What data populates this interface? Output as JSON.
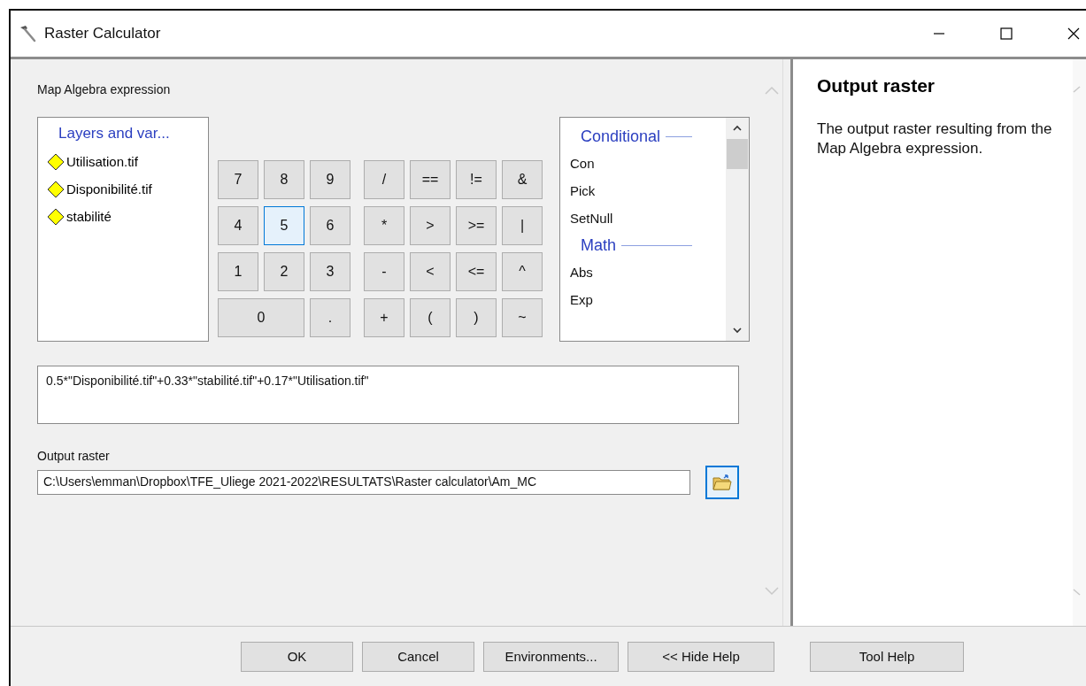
{
  "window": {
    "title": "Raster Calculator"
  },
  "expression_label": "Map Algebra expression",
  "layers": {
    "header": "Layers and var...",
    "items": [
      {
        "name": "Utilisation.tif"
      },
      {
        "name": "Disponibilité.tif"
      },
      {
        "name": "stabilité"
      }
    ]
  },
  "keypad": [
    {
      "label": "7",
      "highlighted": false
    },
    {
      "label": "8",
      "highlighted": false
    },
    {
      "label": "9",
      "highlighted": false
    },
    {
      "label": "4",
      "highlighted": false
    },
    {
      "label": "5",
      "highlighted": true
    },
    {
      "label": "6",
      "highlighted": false
    },
    {
      "label": "1",
      "highlighted": false
    },
    {
      "label": "2",
      "highlighted": false
    },
    {
      "label": "3",
      "highlighted": false
    },
    {
      "label": "0",
      "highlighted": false
    },
    {
      "label": ".",
      "highlighted": false
    }
  ],
  "operators": [
    {
      "label": "/",
      "highlighted": false
    },
    {
      "label": "==",
      "highlighted": false
    },
    {
      "label": "!=",
      "highlighted": false
    },
    {
      "label": "&",
      "highlighted": false
    },
    {
      "label": "*",
      "highlighted": false
    },
    {
      "label": ">",
      "highlighted": false
    },
    {
      "label": ">=",
      "highlighted": false
    },
    {
      "label": "|",
      "highlighted": false
    },
    {
      "label": "-",
      "highlighted": false
    },
    {
      "label": "<",
      "highlighted": false
    },
    {
      "label": "<=",
      "highlighted": false
    },
    {
      "label": "^",
      "highlighted": false
    },
    {
      "label": "+",
      "highlighted": false
    },
    {
      "label": "(",
      "highlighted": false
    },
    {
      "label": ")",
      "highlighted": false
    },
    {
      "label": "~",
      "highlighted": false
    }
  ],
  "functions": [
    {
      "title": "Conditional",
      "items": [
        "Con",
        "Pick",
        "SetNull"
      ]
    },
    {
      "title": "Math",
      "items": [
        "Abs",
        "Exp"
      ]
    }
  ],
  "expression": "0.5*\"Disponibilité.tif\"+0.33*\"stabilité.tif\"+0.17*\"Utilisation.tif\"",
  "output": {
    "label": "Output raster",
    "value": "C:\\Users\\emman\\Dropbox\\TFE_Uliege 2021-2022\\RESULTATS\\Raster calculator\\Am_MC"
  },
  "help": {
    "title": "Output raster",
    "text": "The output raster resulting from the Map Algebra expression."
  },
  "buttons": [
    "OK",
    "Cancel",
    "Environments...",
    "<< Hide Help",
    "Tool Help"
  ]
}
